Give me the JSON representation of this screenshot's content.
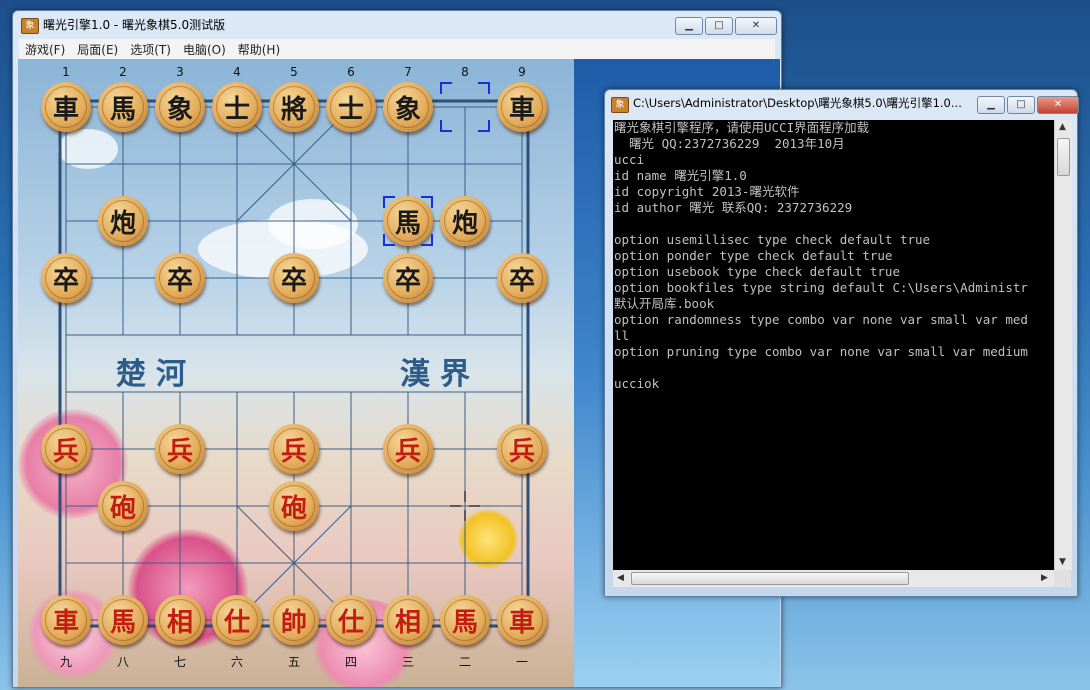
{
  "main_window": {
    "title": "曙光引擎1.0 - 曙光象棋5.0测试版",
    "controls": [
      "▁",
      "□",
      "✕"
    ],
    "menu": [
      "游戏(F)",
      "局面(E)",
      "选项(T)",
      "电脑(O)",
      "帮助(H)"
    ]
  },
  "board": {
    "top_coords": [
      "1",
      "2",
      "3",
      "4",
      "5",
      "6",
      "7",
      "8",
      "9"
    ],
    "bottom_coords": [
      "九",
      "八",
      "七",
      "六",
      "五",
      "四",
      "三",
      "二",
      "一"
    ],
    "river_left": "楚河",
    "river_right": "漢界",
    "pieces": [
      {
        "side": "black",
        "label": "車",
        "col": 0,
        "row": 0
      },
      {
        "side": "black",
        "label": "馬",
        "col": 1,
        "row": 0
      },
      {
        "side": "black",
        "label": "象",
        "col": 2,
        "row": 0
      },
      {
        "side": "black",
        "label": "士",
        "col": 3,
        "row": 0
      },
      {
        "side": "black",
        "label": "將",
        "col": 4,
        "row": 0
      },
      {
        "side": "black",
        "label": "士",
        "col": 5,
        "row": 0
      },
      {
        "side": "black",
        "label": "象",
        "col": 6,
        "row": 0
      },
      {
        "side": "black",
        "label": "車",
        "col": 8,
        "row": 0
      },
      {
        "side": "black",
        "label": "炮",
        "col": 1,
        "row": 2
      },
      {
        "side": "black",
        "label": "馬",
        "col": 6,
        "row": 2
      },
      {
        "side": "black",
        "label": "炮",
        "col": 7,
        "row": 2
      },
      {
        "side": "black",
        "label": "卒",
        "col": 0,
        "row": 3
      },
      {
        "side": "black",
        "label": "卒",
        "col": 2,
        "row": 3
      },
      {
        "side": "black",
        "label": "卒",
        "col": 4,
        "row": 3
      },
      {
        "side": "black",
        "label": "卒",
        "col": 6,
        "row": 3
      },
      {
        "side": "black",
        "label": "卒",
        "col": 8,
        "row": 3
      },
      {
        "side": "red",
        "label": "兵",
        "col": 0,
        "row": 6
      },
      {
        "side": "red",
        "label": "兵",
        "col": 2,
        "row": 6
      },
      {
        "side": "red",
        "label": "兵",
        "col": 4,
        "row": 6
      },
      {
        "side": "red",
        "label": "兵",
        "col": 6,
        "row": 6
      },
      {
        "side": "red",
        "label": "兵",
        "col": 8,
        "row": 6
      },
      {
        "side": "red",
        "label": "砲",
        "col": 1,
        "row": 7
      },
      {
        "side": "red",
        "label": "砲",
        "col": 4,
        "row": 7
      },
      {
        "side": "red",
        "label": "車",
        "col": 0,
        "row": 9
      },
      {
        "side": "red",
        "label": "馬",
        "col": 1,
        "row": 9
      },
      {
        "side": "red",
        "label": "相",
        "col": 2,
        "row": 9
      },
      {
        "side": "red",
        "label": "仕",
        "col": 3,
        "row": 9
      },
      {
        "side": "red",
        "label": "帥",
        "col": 4,
        "row": 9
      },
      {
        "side": "red",
        "label": "仕",
        "col": 5,
        "row": 9
      },
      {
        "side": "red",
        "label": "相",
        "col": 6,
        "row": 9
      },
      {
        "side": "red",
        "label": "馬",
        "col": 7,
        "row": 9
      },
      {
        "side": "red",
        "label": "車",
        "col": 8,
        "row": 9
      }
    ],
    "last_move_from": {
      "col": 7,
      "row": 0
    },
    "last_move_to": {
      "col": 6,
      "row": 2
    },
    "cursor_point": {
      "col": 7,
      "row": 7
    }
  },
  "console_window": {
    "title": "C:\\Users\\Administrator\\Desktop\\曙光象棋5.0\\曙光引擎1.0...",
    "controls": [
      "▁",
      "□",
      "✕"
    ],
    "lines": [
      "曙光象棋引擎程序，请使用UCCI界面程序加载",
      "  曙光 QQ:2372736229  2013年10月",
      "ucci",
      "id name 曙光引擎1.0",
      "id copyright 2013-曙光软件",
      "id author 曙光 联系QQ: 2372736229",
      "",
      "option usemillisec type check default true",
      "option ponder type check default true",
      "option usebook type check default true",
      "option bookfiles type string default C:\\Users\\Administr",
      "默认开局库.book",
      "option randomness type combo var none var small var med",
      "ll",
      "option pruning type combo var none var small var medium",
      "",
      "ucciok"
    ]
  },
  "colors": {
    "black_piece_text": "#1a1a1a",
    "red_piece_text": "#c21d10",
    "selection": "#1530d8",
    "console_bg": "#000000",
    "console_text": "#c0c0c0"
  }
}
